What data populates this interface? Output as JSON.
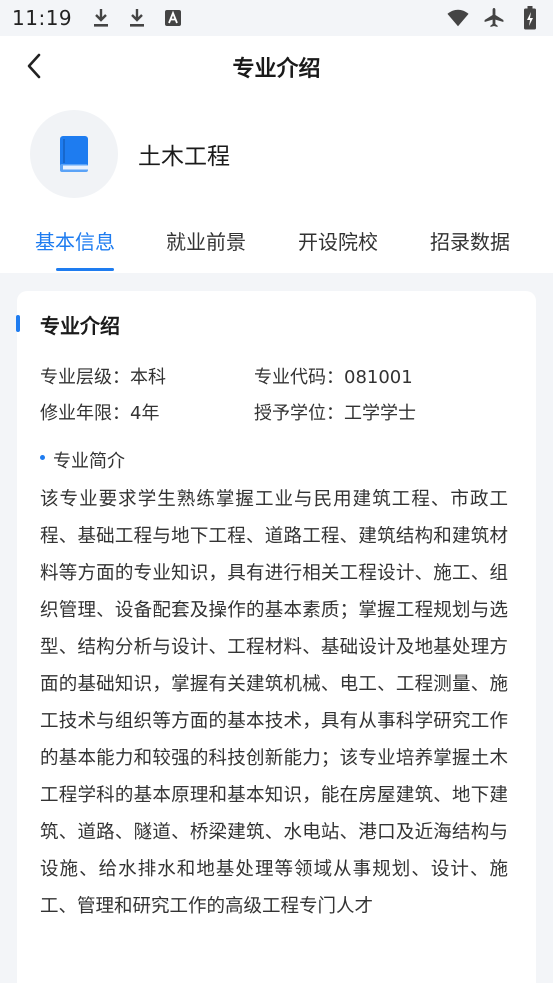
{
  "status_bar": {
    "time": "11:19",
    "left_icons": [
      "download-icon",
      "download-icon",
      "font-icon"
    ],
    "right_icons": [
      "wifi-icon",
      "airplane-icon",
      "battery-charging-icon"
    ]
  },
  "nav": {
    "title": "专业介绍",
    "back_icon": "chevron-left-icon"
  },
  "major": {
    "name": "土木工程",
    "icon": "book-icon"
  },
  "tabs": [
    {
      "label": "基本信息",
      "active": true
    },
    {
      "label": "就业前景",
      "active": false
    },
    {
      "label": "开设院校",
      "active": false
    },
    {
      "label": "招录数据",
      "active": false
    }
  ],
  "card": {
    "section_title": "专业介绍",
    "level_label": "专业层级：",
    "level_value": "本科",
    "code_label": "专业代码：",
    "code_value": "081001",
    "duration_label": "修业年限：",
    "duration_value": "4年",
    "degree_label": "授予学位：",
    "degree_value": "工学学士",
    "summary_heading": "专业简介",
    "summary_text": "该专业要求学生熟练掌握工业与民用建筑工程、市政工程、基础工程与地下工程、道路工程、建筑结构和建筑材料等方面的专业知识，具有进行相关工程设计、施工、组织管理、设备配套及操作的基本素质；掌握工程规划与选型、结构分析与设计、工程材料、基础设计及地基处理方面的基础知识，掌握有关建筑机械、电工、工程测量、施工技术与组织等方面的基本技术，具有从事科学研究工作的基本能力和较强的科技创新能力；该专业培养掌握土木工程学科的基本原理和基本知识，能在房屋建筑、地下建筑、道路、隧道、桥梁建筑、水电站、港口及近海结构与设施、给水排水和地基处理等领域从事规划、设计、施工、管理和研究工作的高级工程专门人才"
  },
  "colors": {
    "accent": "#1e7cf0",
    "background": "#f3f5f8",
    "card": "#ffffff"
  }
}
